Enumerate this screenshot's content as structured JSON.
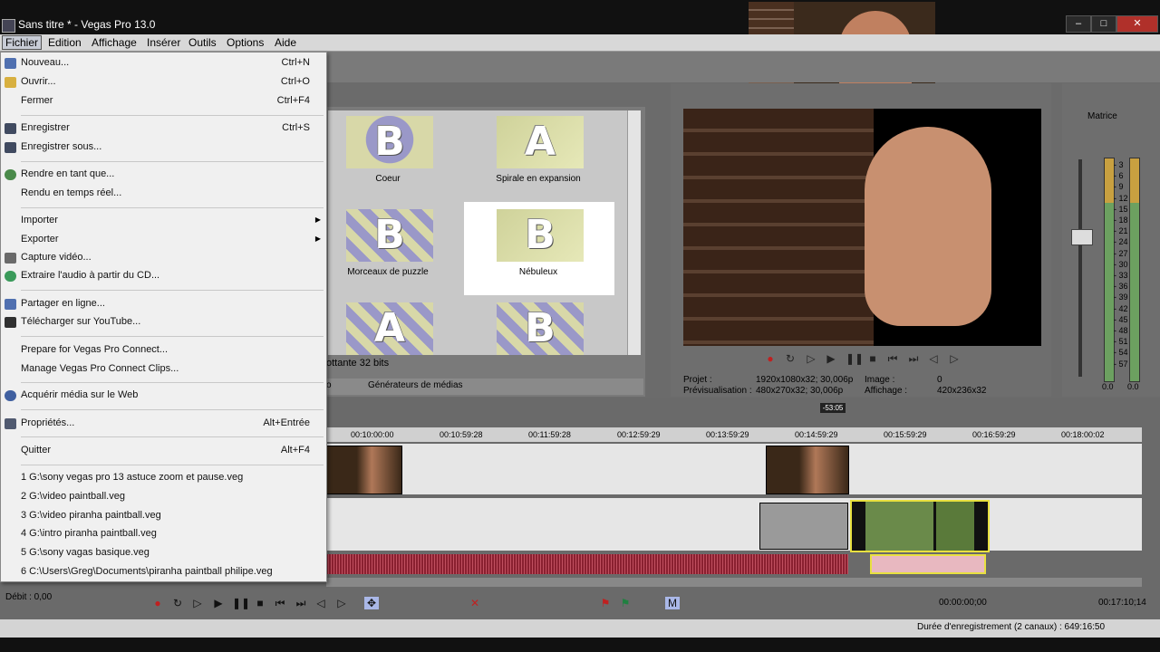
{
  "window": {
    "title": "Sans titre * - Vegas Pro 13.0",
    "buttons": [
      "–",
      "□",
      "✕"
    ]
  },
  "menubar": {
    "items": [
      "Fichier",
      "Edition",
      "Affichage",
      "Insérer",
      "Outils",
      "Options",
      "Aide"
    ]
  },
  "file_menu": {
    "items": [
      {
        "label": "Nouveau...",
        "shortcut": "Ctrl+N"
      },
      {
        "label": "Ouvrir...",
        "shortcut": "Ctrl+O"
      },
      {
        "label": "Fermer",
        "shortcut": "Ctrl+F4"
      },
      {
        "label": "Enregistrer",
        "shortcut": "Ctrl+S"
      },
      {
        "label": "Enregistrer sous...",
        "shortcut": ""
      },
      {
        "label": "Rendre en tant que...",
        "shortcut": ""
      },
      {
        "label": "Rendu en temps réel...",
        "shortcut": ""
      },
      {
        "label": "Importer",
        "shortcut": ""
      },
      {
        "label": "Exporter",
        "shortcut": ""
      },
      {
        "label": "Capture vidéo...",
        "shortcut": ""
      },
      {
        "label": "Extraire l'audio à partir du CD...",
        "shortcut": ""
      },
      {
        "label": "Partager en ligne...",
        "shortcut": ""
      },
      {
        "label": "Télécharger sur YouTube...",
        "shortcut": ""
      },
      {
        "label": "Prepare for Vegas Pro Connect...",
        "shortcut": ""
      },
      {
        "label": "Manage Vegas Pro Connect Clips...",
        "shortcut": ""
      },
      {
        "label": "Acquérir média sur le Web",
        "shortcut": ""
      },
      {
        "label": "Propriétés...",
        "shortcut": "Alt+Entrée"
      },
      {
        "label": "Quitter",
        "shortcut": "Alt+F4"
      },
      {
        "label": "1 G:\\sony vegas pro 13 astuce zoom et pause.veg",
        "shortcut": ""
      },
      {
        "label": "2 G:\\video paintball.veg",
        "shortcut": ""
      },
      {
        "label": "3 G:\\video piranha paintball.veg",
        "shortcut": ""
      },
      {
        "label": "4 G:\\intro piranha paintball.veg",
        "shortcut": ""
      },
      {
        "label": "5 G:\\sony vagas basique.veg",
        "shortcut": ""
      },
      {
        "label": "6 C:\\Users\\Greg\\Documents\\piranha paintball philipe.veg",
        "shortcut": ""
      }
    ]
  },
  "transitions": {
    "items": [
      "Coeur",
      "Spirale en expansion",
      "Morceaux de puzzle",
      "Nébuleux"
    ],
    "letters": [
      "B",
      "A",
      "B",
      "B",
      "A",
      "B"
    ],
    "status_fragment": "ottante 32 bits",
    "tabs": [
      "o",
      "Générateurs de médias"
    ]
  },
  "preview": {
    "projet_label": "Projet :",
    "projet_value": "1920x1080x32; 30,006p",
    "previsu_label": "Prévisualisation :",
    "previsu_value": "480x270x32; 30,006p",
    "image_label": "Image :",
    "image_value": "0",
    "affichage_label": "Affichage :",
    "affichage_value": "420x236x32"
  },
  "master": {
    "title": "Matrice",
    "levels": [
      "3",
      "6",
      "9",
      "12",
      "15",
      "18",
      "21",
      "24",
      "27",
      "30",
      "33",
      "36",
      "39",
      "42",
      "45",
      "48",
      "51",
      "54",
      "57"
    ],
    "readout_left": "0.0",
    "readout_right": "0.0"
  },
  "timeline": {
    "marker": "-53:05",
    "timecodes": [
      "00:10:00:00",
      "00:10:59:28",
      "00:11:59:28",
      "00:12:59:29",
      "00:13:59:29",
      "00:14:59:29",
      "00:15:59:29",
      "00:16:59:29",
      "00:18:00:02"
    ]
  },
  "bottom": {
    "debit": "Débit : 0,00",
    "timecode": "00:00:00;00",
    "end_time": "00:17:10;14",
    "status": "Durée d'enregistrement (2 canaux) : 649:16:50"
  }
}
